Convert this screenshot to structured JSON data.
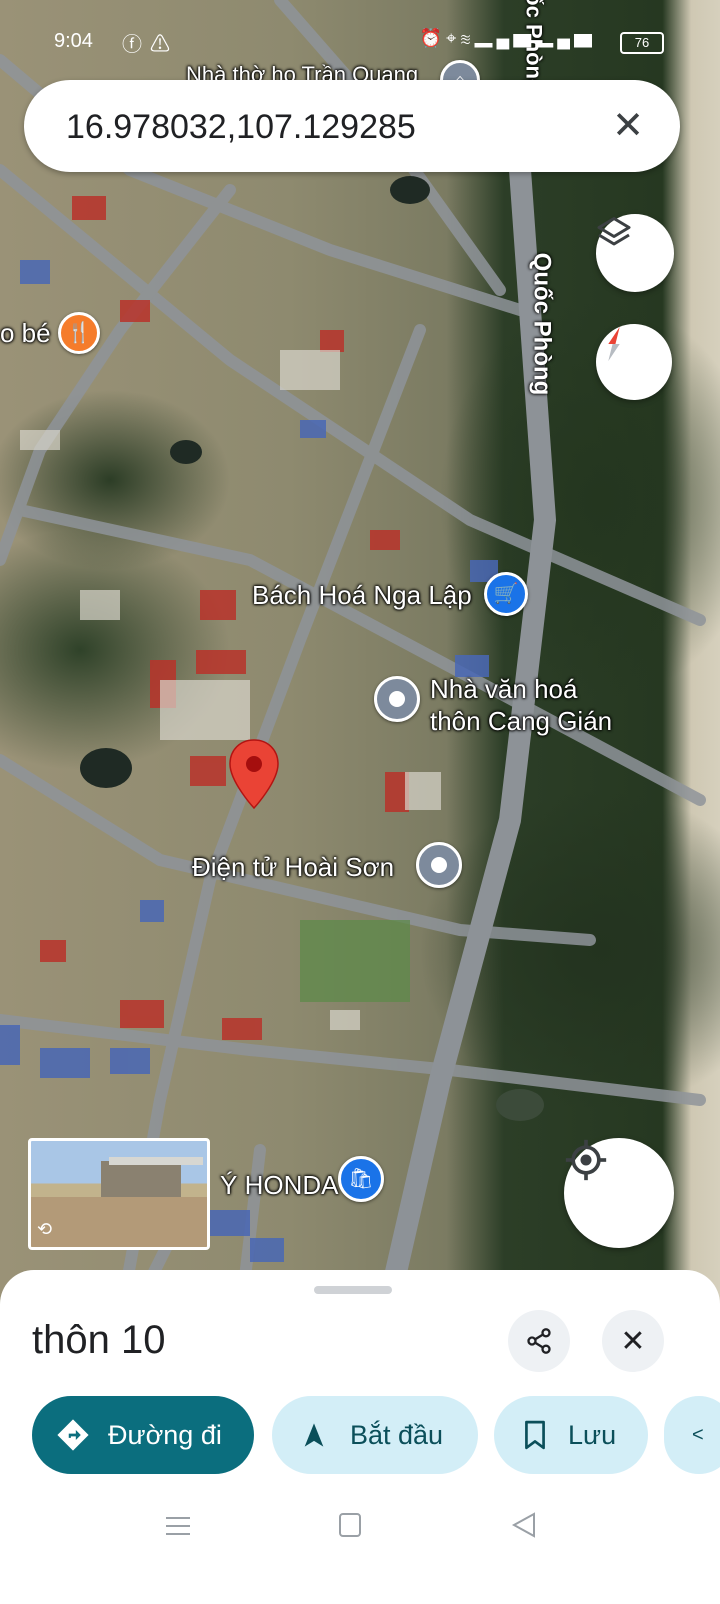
{
  "status_bar": {
    "time": "9:04",
    "left_icons": [
      "facebook-icon",
      "warning-icon"
    ],
    "right_icons": [
      "alarm-icon",
      "location-icon",
      "wifi-icon",
      "signal-icon",
      "signal-icon"
    ],
    "battery": "76"
  },
  "search": {
    "value": "16.978032,107.129285"
  },
  "map": {
    "road_labels": [
      {
        "text": "Quốc Phòng"
      },
      {
        "text": "Quốc Phòng"
      }
    ],
    "places": [
      {
        "name": "Nhà thờ họ Trần Quang",
        "type": "worship"
      },
      {
        "name": "o bé",
        "type": "restaurant"
      },
      {
        "name": "Bách Hoá Nga Lập",
        "type": "shopping-cart"
      },
      {
        "name_line1": "Nhà văn hoá",
        "name_line2": "thôn Cang Gián",
        "type": "landmark"
      },
      {
        "name": "Điện tử Hoài Sơn",
        "type": "landmark"
      },
      {
        "name": "Ý HONDA",
        "type": "shopping-bag"
      }
    ],
    "accent_red": "#ea4335",
    "poi_blue": "#1a73e8",
    "poi_orange": "#f57c2b",
    "poi_gray": "#7d8a9c"
  },
  "sheet": {
    "title": "thôn 10",
    "actions": [
      {
        "label": "Đường đi",
        "icon": "directions-icon"
      },
      {
        "label": "Bắt đầu",
        "icon": "navigation-icon"
      },
      {
        "label": "Lưu",
        "icon": "bookmark-icon"
      }
    ],
    "primary_color": "#0b6e7e",
    "chip_color": "#d3eef7"
  }
}
